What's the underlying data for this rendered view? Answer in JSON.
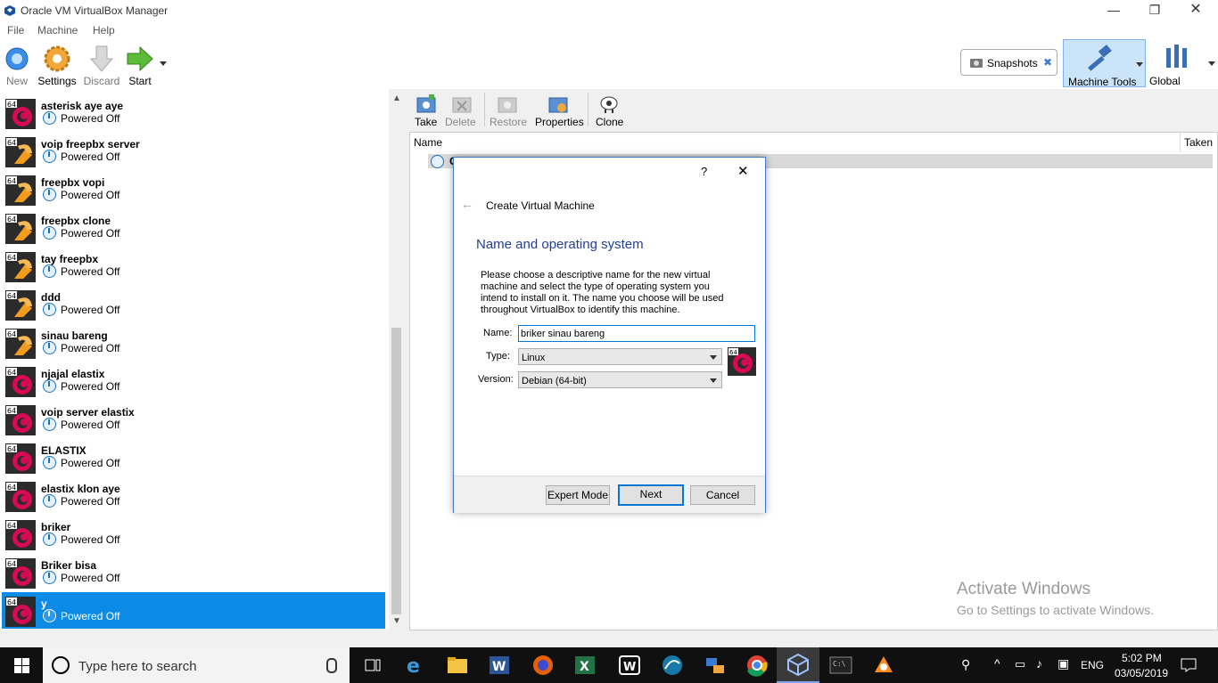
{
  "window": {
    "title": "Oracle VM VirtualBox Manager"
  },
  "menu": [
    "File",
    "Machine",
    "Help"
  ],
  "toolbar": {
    "new": "New",
    "settings": "Settings",
    "discard": "Discard",
    "start": "Start",
    "snapshots": "Snapshots",
    "machine_tools": "Machine Tools",
    "global_tools": "Global Tools"
  },
  "vms": [
    {
      "name": "asterisk aye aye",
      "state": "Powered Off",
      "os": "debian"
    },
    {
      "name": "voip freepbx server",
      "state": "Powered Off",
      "os": "other"
    },
    {
      "name": "freepbx vopi",
      "state": "Powered Off",
      "os": "other"
    },
    {
      "name": "freepbx clone",
      "state": "Powered Off",
      "os": "other"
    },
    {
      "name": "tay freepbx",
      "state": "Powered Off",
      "os": "other"
    },
    {
      "name": "ddd",
      "state": "Powered Off",
      "os": "other"
    },
    {
      "name": "sinau bareng",
      "state": "Powered Off",
      "os": "other"
    },
    {
      "name": "njajal elastix",
      "state": "Powered Off",
      "os": "debian"
    },
    {
      "name": "voip server elastix",
      "state": "Powered Off",
      "os": "debian"
    },
    {
      "name": "ELASTIX",
      "state": "Powered Off",
      "os": "debian"
    },
    {
      "name": "elastix klon aye",
      "state": "Powered Off",
      "os": "debian"
    },
    {
      "name": "briker",
      "state": "Powered Off",
      "os": "debian"
    },
    {
      "name": "Briker bisa",
      "state": "Powered Off",
      "os": "debian"
    },
    {
      "name": "y",
      "state": "Powered Off",
      "os": "debian",
      "selected": true
    }
  ],
  "snap_toolbar": {
    "take": "Take",
    "delete": "Delete",
    "restore": "Restore",
    "properties": "Properties",
    "clone": "Clone"
  },
  "snap_table": {
    "col_name": "Name",
    "col_taken": "Taken",
    "row_first_char": "C"
  },
  "dialog": {
    "help": "?",
    "close": "✕",
    "back": "←",
    "wizard_title": "Create Virtual Machine",
    "heading": "Name and operating system",
    "description": "Please choose a descriptive name for the new virtual machine and select the type of operating system you intend to install on it. The name you choose will be used throughout VirtualBox to identify this machine.",
    "name_label": "Name:",
    "name_value": "briker sinau bareng",
    "type_label": "Type:",
    "type_value": "Linux",
    "version_label": "Version:",
    "version_value": "Debian (64-bit)",
    "expert_mode": "Expert Mode",
    "next": "Next",
    "cancel": "Cancel"
  },
  "watermark": {
    "line1": "Activate Windows",
    "line2": "Go to Settings to activate Windows."
  },
  "taskbar": {
    "search_placeholder": "Type here to search",
    "language": "ENG",
    "time": "5:02 PM",
    "date": "03/05/2019"
  }
}
